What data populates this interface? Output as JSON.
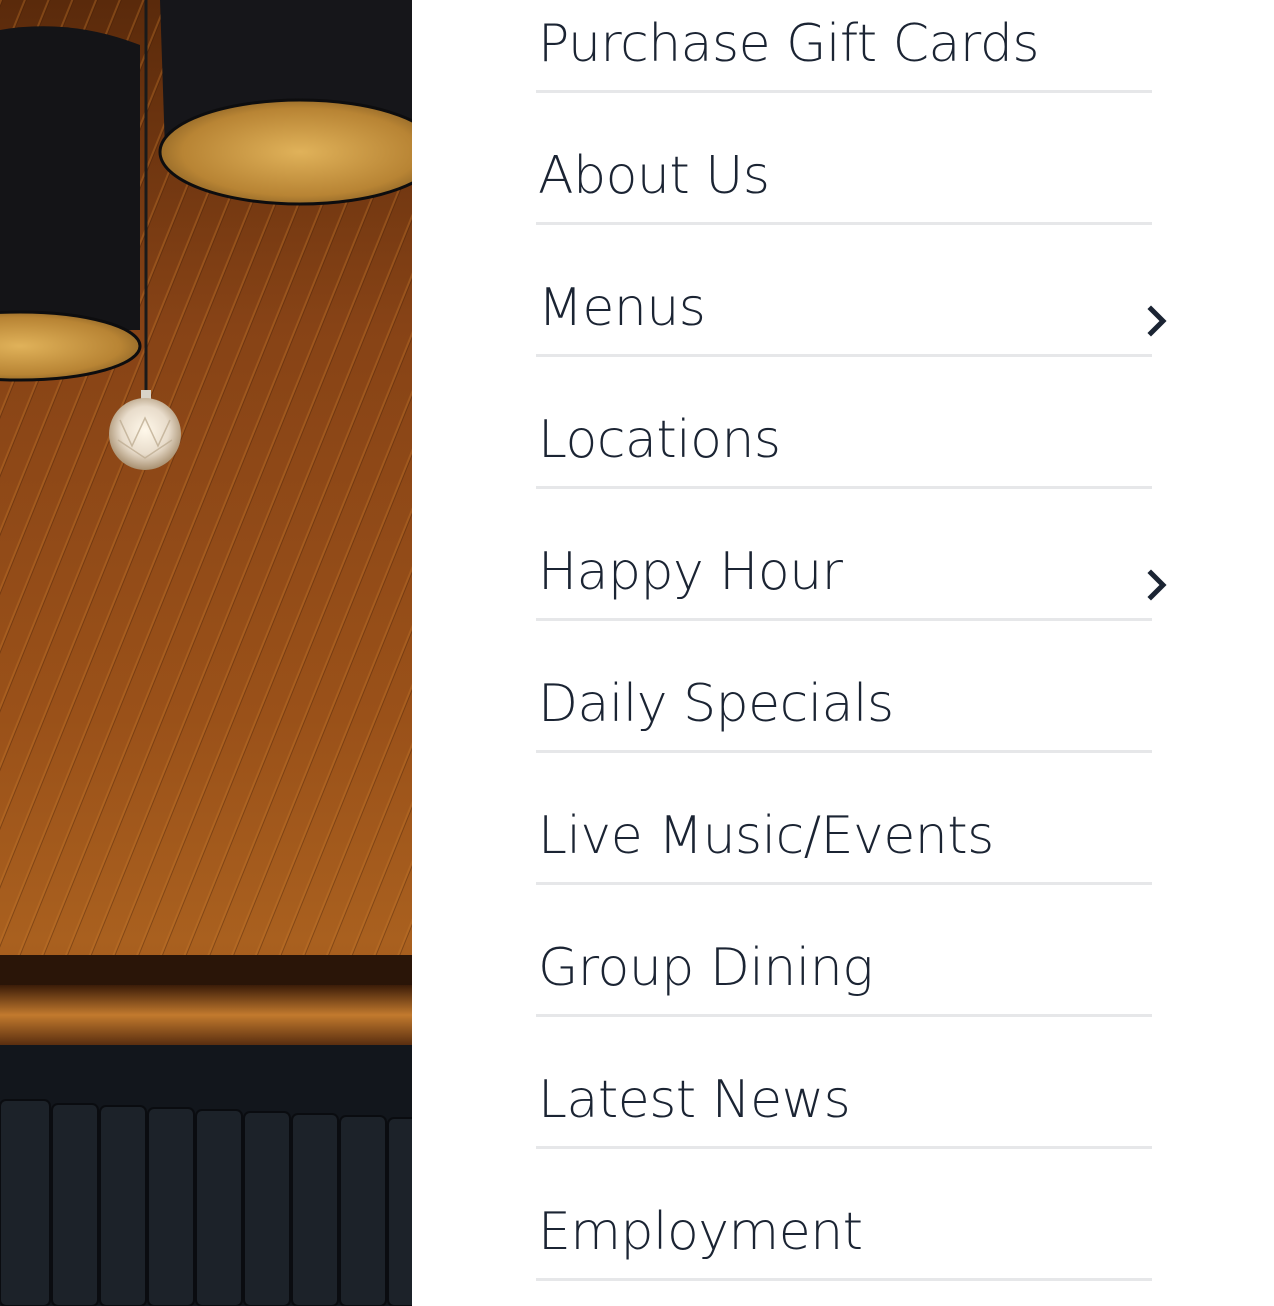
{
  "photo": {
    "icon": "restaurant-interior-photo"
  },
  "colors": {
    "text": "#1b2433",
    "divider": "#e6e7e9",
    "wood": "#8a4a17",
    "background": "#ffffff"
  },
  "nav": {
    "items": [
      {
        "label": "Purchase Gift Cards",
        "has_submenu": false
      },
      {
        "label": "About Us",
        "has_submenu": false
      },
      {
        "label": "Menus",
        "has_submenu": true,
        "icon": "chevron-right-icon"
      },
      {
        "label": "Locations",
        "has_submenu": false
      },
      {
        "label": "Happy Hour",
        "has_submenu": true,
        "icon": "chevron-right-icon"
      },
      {
        "label": "Daily Specials",
        "has_submenu": false
      },
      {
        "label": "Live Music/Events",
        "has_submenu": false
      },
      {
        "label": "Group Dining",
        "has_submenu": false
      },
      {
        "label": "Latest News",
        "has_submenu": false
      },
      {
        "label": "Employment",
        "has_submenu": false
      }
    ]
  }
}
